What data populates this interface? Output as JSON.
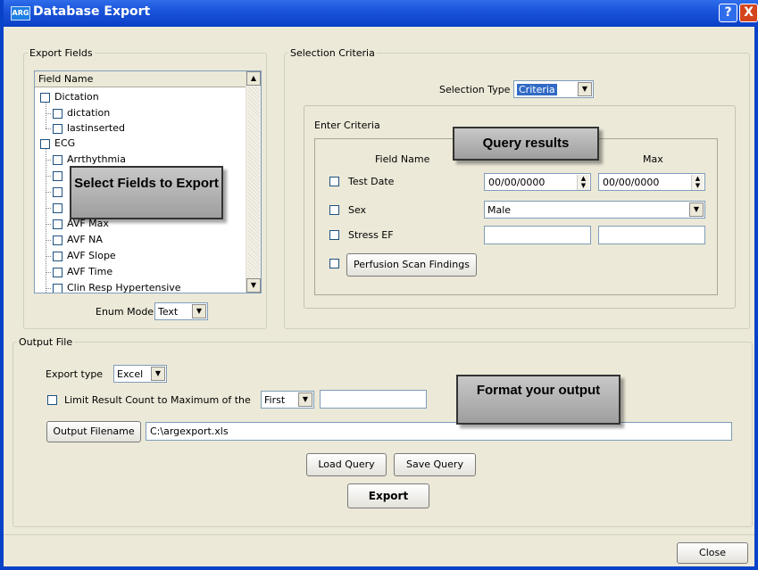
{
  "window": {
    "title": "Database Export",
    "icon_label": "ARG",
    "help_btn": "?",
    "close_btn": "X"
  },
  "export_fields": {
    "legend": "Export Fields",
    "list_header": "Field Name",
    "items": [
      {
        "label": "Dictation",
        "level": 0
      },
      {
        "label": "dictation",
        "level": 1
      },
      {
        "label": "lastinserted",
        "level": 1
      },
      {
        "label": "ECG",
        "level": 0
      },
      {
        "label": "Arrthythmia",
        "level": 1
      },
      {
        "label": "",
        "level": 1
      },
      {
        "label": "",
        "level": 1
      },
      {
        "label": "",
        "level": 1
      },
      {
        "label": "AVF Max",
        "level": 1
      },
      {
        "label": "AVF NA",
        "level": 1
      },
      {
        "label": "AVF Slope",
        "level": 1
      },
      {
        "label": "AVF Time",
        "level": 1
      },
      {
        "label": "Clin Resp Hypertensive",
        "level": 1
      }
    ],
    "enum_mode_label": "Enum Mode",
    "enum_mode_value": "Text"
  },
  "selection_criteria": {
    "legend": "Selection Criteria",
    "type_label": "Selection Type",
    "type_value": "Criteria",
    "enter_criteria": {
      "legend": "Enter Criteria",
      "col_field": "Field Name",
      "col_max": "Max",
      "rows": [
        {
          "label": "Test Date",
          "min": "00/00/0000",
          "max": "00/00/0000"
        },
        {
          "label": "Sex",
          "value": "Male"
        },
        {
          "label": "Stress EF",
          "min": "",
          "max": ""
        }
      ],
      "perfusion_button": "Perfusion Scan Findings"
    }
  },
  "output_file": {
    "legend": "Output File",
    "export_type_label": "Export type",
    "export_type_value": "Excel",
    "limit_label": "Limit Result Count to Maximum of the",
    "limit_value": "First",
    "limit_count": "",
    "output_filename_button": "Output Filename",
    "output_filename_value": "C:\\argexport.xls",
    "load_query": "Load Query",
    "save_query": "Save Query",
    "export": "Export"
  },
  "close_button": "Close",
  "callouts": {
    "select_fields": "Select Fields to Export",
    "query_results": "Query results",
    "format_output": "Format your output"
  }
}
